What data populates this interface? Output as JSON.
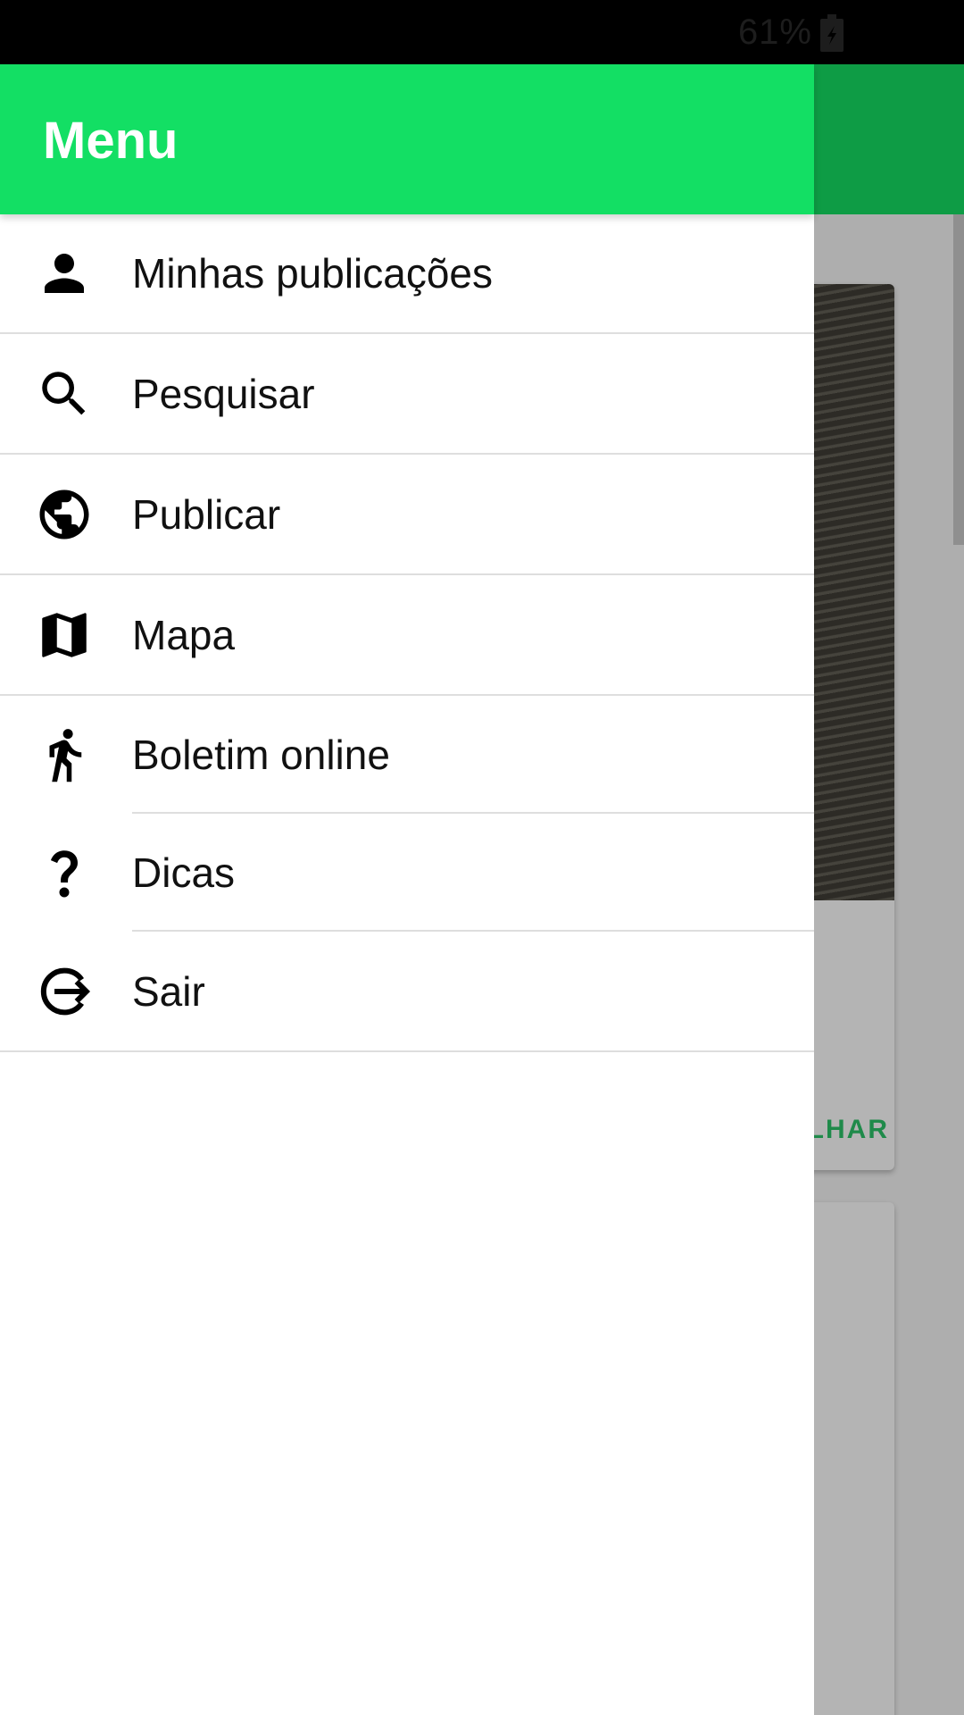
{
  "status_bar": {
    "battery_percent": "61%"
  },
  "drawer": {
    "title": "Menu",
    "items": [
      {
        "label": "Minhas publicações",
        "icon": "person-icon"
      },
      {
        "label": "Pesquisar",
        "icon": "search-icon"
      },
      {
        "label": "Publicar",
        "icon": "globe-icon"
      },
      {
        "label": "Mapa",
        "icon": "map-icon"
      },
      {
        "label": "Boletim online",
        "icon": "walk-icon"
      },
      {
        "label": "Dicas",
        "icon": "help-icon"
      },
      {
        "label": "Sair",
        "icon": "logout-icon"
      }
    ]
  },
  "background": {
    "card_action_label": "LHAR"
  },
  "colors": {
    "drawer_header": "#13df64",
    "background_appbar": "#0e9c45",
    "card_action": "#1f8a4a"
  }
}
